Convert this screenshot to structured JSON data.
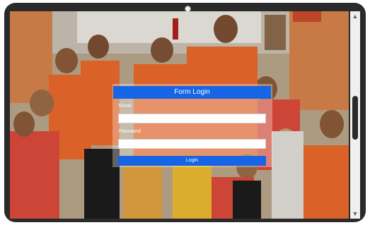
{
  "login_form": {
    "title": "Form Login",
    "email_label": "Email",
    "email_value": "",
    "password_label": "Password",
    "password_value": "",
    "submit_label": "Login"
  },
  "background_photo": {
    "description": "group photo of students in orange vests in front of building"
  },
  "scrollbar": {
    "up_arrow": "▲",
    "down_arrow": "▼"
  },
  "colors": {
    "accent": "#1565e6",
    "bezel": "#2a2a2a",
    "vest": "#e8682a"
  }
}
